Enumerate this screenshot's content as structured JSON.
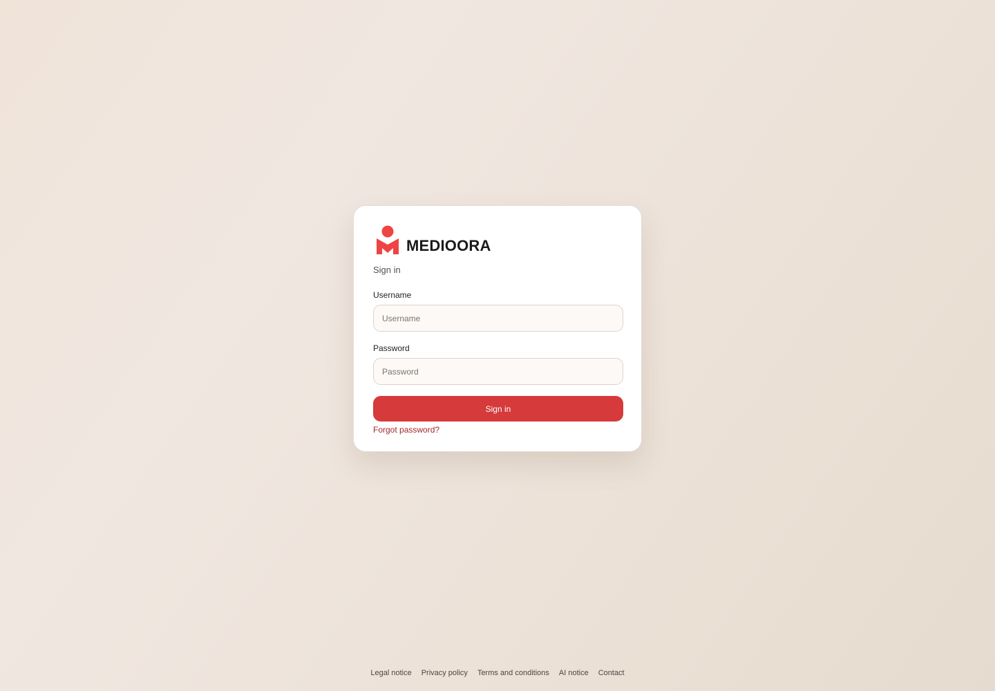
{
  "brand": {
    "name": "MEDIOORA",
    "logo_icon": "medioora-logo-icon",
    "accent_color": "#ef4444"
  },
  "login": {
    "subtitle": "Sign in",
    "username_label": "Username",
    "username_placeholder": "Username",
    "username_value": "",
    "password_label": "Password",
    "password_placeholder": "Password",
    "password_value": "",
    "submit_label": "Sign in",
    "submit_color": "#d63a3a",
    "forgot_label": "Forgot password?"
  },
  "footer": {
    "links": [
      {
        "label": "Legal notice"
      },
      {
        "label": "Privacy policy"
      },
      {
        "label": "Terms and conditions"
      },
      {
        "label": "AI notice"
      },
      {
        "label": "Contact"
      }
    ]
  }
}
